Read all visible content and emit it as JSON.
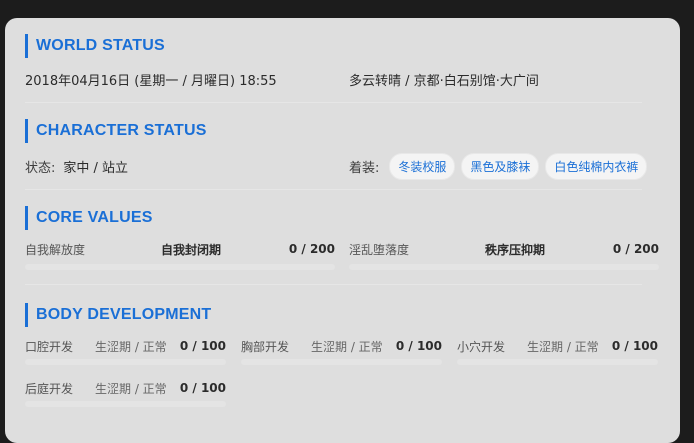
{
  "world": {
    "title": "WORLD STATUS",
    "datetime": "2018年04月16日 (星期一 / 月曜日) 18:55",
    "location": "多云转晴 / 京都·白石别馆·大广间"
  },
  "character": {
    "title": "CHARACTER STATUS",
    "state_label": "状态:",
    "state_value": "家中 / 站立",
    "outfit_label": "着装:",
    "outfit": [
      "冬装校服",
      "黑色及膝袜",
      "白色纯棉内衣裤"
    ]
  },
  "core": {
    "title": "CORE VALUES",
    "stats": [
      {
        "label": "自我解放度",
        "phase": "自我封闭期",
        "value": "0 / 200",
        "progress": 0
      },
      {
        "label": "淫乱堕落度",
        "phase": "秩序压抑期",
        "value": "0 / 200",
        "progress": 0
      }
    ]
  },
  "body": {
    "title": "BODY DEVELOPMENT",
    "stats": [
      {
        "label": "口腔开发",
        "phase": "生涩期 / 正常",
        "value": "0 / 100",
        "progress": 0
      },
      {
        "label": "胸部开发",
        "phase": "生涩期 / 正常",
        "value": "0 / 100",
        "progress": 0
      },
      {
        "label": "小穴开发",
        "phase": "生涩期 / 正常",
        "value": "0 / 100",
        "progress": 0
      },
      {
        "label": "后庭开发",
        "phase": "生涩期 / 正常",
        "value": "0 / 100",
        "progress": 0
      }
    ]
  },
  "colors": {
    "accent": "#1a6fd6",
    "panel_bg": "#dedede",
    "page_bg": "#1c1c1c"
  }
}
